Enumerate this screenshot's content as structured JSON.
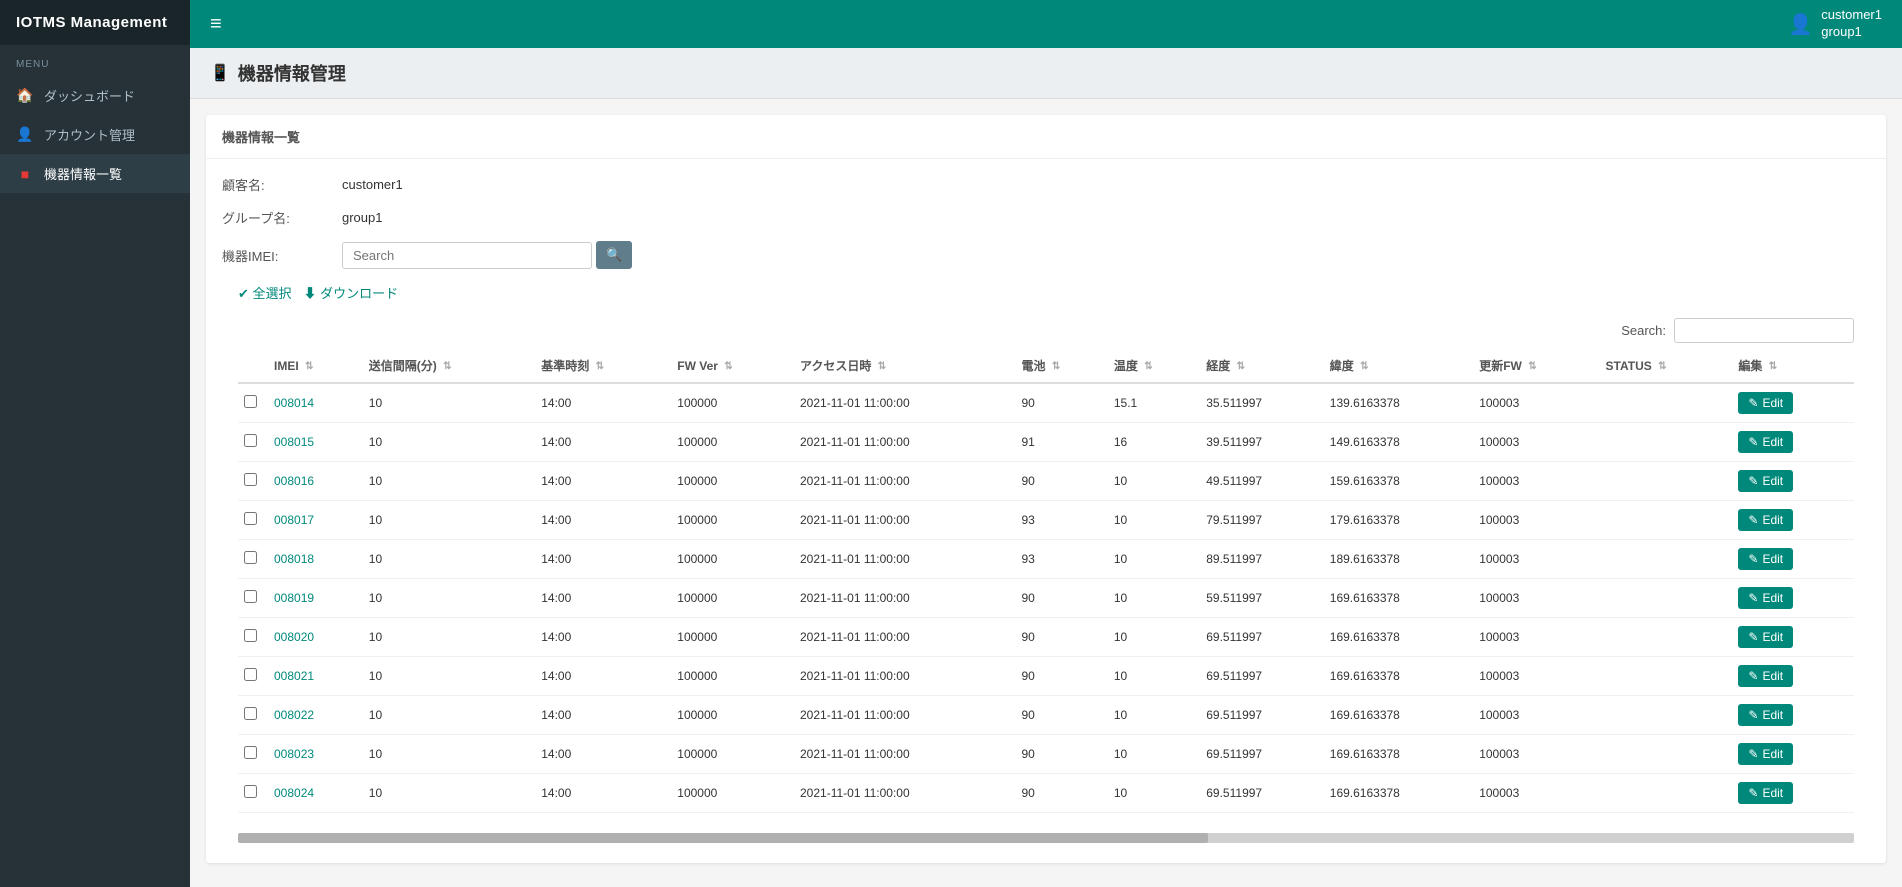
{
  "app": {
    "title": "IOTMS Management"
  },
  "topbar": {
    "hamburger": "≡",
    "user_name": "customer1",
    "user_group": "group1"
  },
  "sidebar": {
    "menu_label": "MENU",
    "items": [
      {
        "id": "dashboard",
        "label": "ダッシュボード",
        "icon": "🏠",
        "active": false
      },
      {
        "id": "account",
        "label": "アカウント管理",
        "icon": "👤",
        "active": false
      },
      {
        "id": "devices",
        "label": "機器情報一覧",
        "icon": "■",
        "active": true
      }
    ]
  },
  "page": {
    "title": "機器情報管理",
    "title_icon": "📱",
    "card_header": "機器情報一覧",
    "customer_label": "顧客名:",
    "customer_value": "customer1",
    "group_label": "グループ名:",
    "group_value": "group1",
    "imei_label": "機器IMEI:",
    "imei_placeholder": "Search",
    "select_all_label": "✔ 全選択",
    "download_label": "⬇ ダウンロード",
    "search_label": "Search:",
    "search_placeholder": ""
  },
  "table": {
    "columns": [
      {
        "id": "checkbox",
        "label": ""
      },
      {
        "id": "imei",
        "label": "IMEI",
        "sortable": true
      },
      {
        "id": "interval",
        "label": "送信間隔(分)",
        "sortable": true
      },
      {
        "id": "base_time",
        "label": "基準時刻",
        "sortable": true
      },
      {
        "id": "fw_ver",
        "label": "FW Ver",
        "sortable": true
      },
      {
        "id": "access_time",
        "label": "アクセス日時",
        "sortable": true
      },
      {
        "id": "battery",
        "label": "電池",
        "sortable": true
      },
      {
        "id": "temperature",
        "label": "温度",
        "sortable": true
      },
      {
        "id": "longitude",
        "label": "経度",
        "sortable": true
      },
      {
        "id": "latitude",
        "label": "緯度",
        "sortable": true
      },
      {
        "id": "update_fw",
        "label": "更新FW",
        "sortable": true
      },
      {
        "id": "status",
        "label": "STATUS",
        "sortable": true
      },
      {
        "id": "edit",
        "label": "編集",
        "sortable": true
      }
    ],
    "rows": [
      {
        "imei": "008014",
        "interval": "10",
        "base_time": "14:00",
        "fw_ver": "100000",
        "access_time": "2021-11-01 11:00:00",
        "battery": "90",
        "temperature": "15.1",
        "longitude": "35.511997",
        "latitude": "139.6163378",
        "update_fw": "100003",
        "status": ""
      },
      {
        "imei": "008015",
        "interval": "10",
        "base_time": "14:00",
        "fw_ver": "100000",
        "access_time": "2021-11-01 11:00:00",
        "battery": "91",
        "temperature": "16",
        "longitude": "39.511997",
        "latitude": "149.6163378",
        "update_fw": "100003",
        "status": ""
      },
      {
        "imei": "008016",
        "interval": "10",
        "base_time": "14:00",
        "fw_ver": "100000",
        "access_time": "2021-11-01 11:00:00",
        "battery": "90",
        "temperature": "10",
        "longitude": "49.511997",
        "latitude": "159.6163378",
        "update_fw": "100003",
        "status": ""
      },
      {
        "imei": "008017",
        "interval": "10",
        "base_time": "14:00",
        "fw_ver": "100000",
        "access_time": "2021-11-01 11:00:00",
        "battery": "93",
        "temperature": "10",
        "longitude": "79.511997",
        "latitude": "179.6163378",
        "update_fw": "100003",
        "status": ""
      },
      {
        "imei": "008018",
        "interval": "10",
        "base_time": "14:00",
        "fw_ver": "100000",
        "access_time": "2021-11-01 11:00:00",
        "battery": "93",
        "temperature": "10",
        "longitude": "89.511997",
        "latitude": "189.6163378",
        "update_fw": "100003",
        "status": ""
      },
      {
        "imei": "008019",
        "interval": "10",
        "base_time": "14:00",
        "fw_ver": "100000",
        "access_time": "2021-11-01 11:00:00",
        "battery": "90",
        "temperature": "10",
        "longitude": "59.511997",
        "latitude": "169.6163378",
        "update_fw": "100003",
        "status": ""
      },
      {
        "imei": "008020",
        "interval": "10",
        "base_time": "14:00",
        "fw_ver": "100000",
        "access_time": "2021-11-01 11:00:00",
        "battery": "90",
        "temperature": "10",
        "longitude": "69.511997",
        "latitude": "169.6163378",
        "update_fw": "100003",
        "status": ""
      },
      {
        "imei": "008021",
        "interval": "10",
        "base_time": "14:00",
        "fw_ver": "100000",
        "access_time": "2021-11-01 11:00:00",
        "battery": "90",
        "temperature": "10",
        "longitude": "69.511997",
        "latitude": "169.6163378",
        "update_fw": "100003",
        "status": ""
      },
      {
        "imei": "008022",
        "interval": "10",
        "base_time": "14:00",
        "fw_ver": "100000",
        "access_time": "2021-11-01 11:00:00",
        "battery": "90",
        "temperature": "10",
        "longitude": "69.511997",
        "latitude": "169.6163378",
        "update_fw": "100003",
        "status": ""
      },
      {
        "imei": "008023",
        "interval": "10",
        "base_time": "14:00",
        "fw_ver": "100000",
        "access_time": "2021-11-01 11:00:00",
        "battery": "90",
        "temperature": "10",
        "longitude": "69.511997",
        "latitude": "169.6163378",
        "update_fw": "100003",
        "status": ""
      },
      {
        "imei": "008024",
        "interval": "10",
        "base_time": "14:00",
        "fw_ver": "100000",
        "access_time": "2021-11-01 11:00:00",
        "battery": "90",
        "temperature": "10",
        "longitude": "69.511997",
        "latitude": "169.6163378",
        "update_fw": "100003",
        "status": ""
      }
    ],
    "edit_label": "✎ Edit"
  },
  "colors": {
    "sidebar_bg": "#263238",
    "topbar_bg": "#00897b",
    "link_color": "#00897b",
    "edit_btn_bg": "#00897b"
  }
}
